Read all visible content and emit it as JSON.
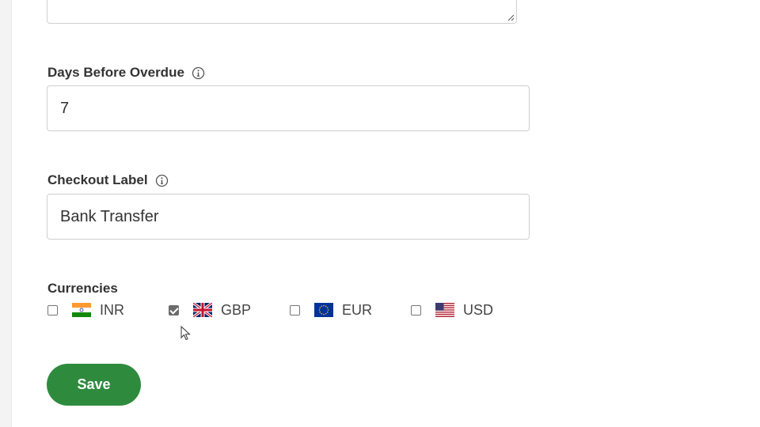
{
  "days_before_overdue": {
    "label": "Days Before Overdue",
    "value": "7"
  },
  "checkout_label": {
    "label": "Checkout Label",
    "value": "Bank Transfer"
  },
  "currencies": {
    "label": "Currencies",
    "items": [
      {
        "code": "INR",
        "checked": false,
        "flag": "india-flag-icon"
      },
      {
        "code": "GBP",
        "checked": true,
        "flag": "uk-flag-icon"
      },
      {
        "code": "EUR",
        "checked": false,
        "flag": "eu-flag-icon"
      },
      {
        "code": "USD",
        "checked": false,
        "flag": "us-flag-icon"
      }
    ]
  },
  "save_button": {
    "label": "Save",
    "color": "#2e8b3e"
  },
  "colors": {
    "text": "#333333",
    "border": "#cfcfcf"
  }
}
